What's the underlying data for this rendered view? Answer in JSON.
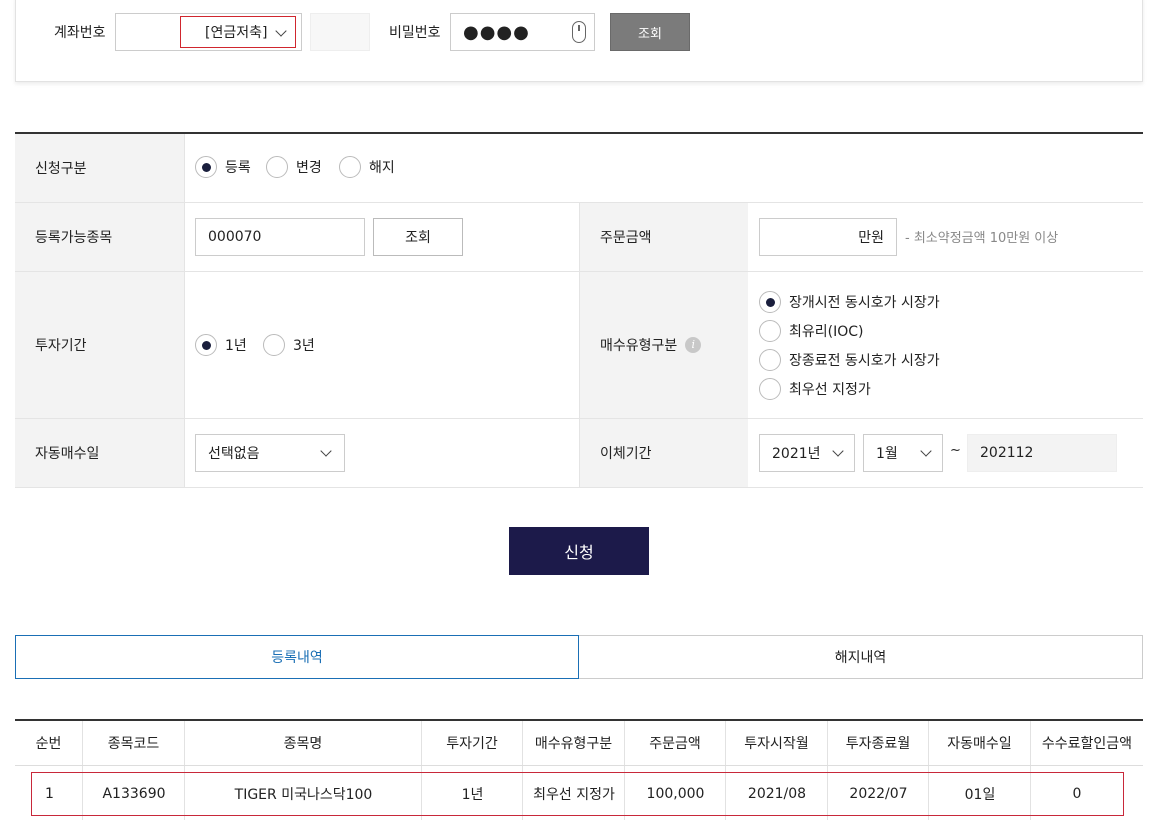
{
  "search": {
    "account_label": "계좌번호",
    "account_type": "[연금저축]",
    "password_label": "비밀번호",
    "password_mask": "●●●●",
    "query_button": "조회"
  },
  "form": {
    "apply_type_label": "신청구분",
    "apply_options": [
      "등록",
      "변경",
      "해지"
    ],
    "apply_selected": "등록",
    "stock_label": "등록가능종목",
    "stock_code": "000070",
    "stock_query_button": "조회",
    "order_amount_label": "주문금액",
    "order_amount_unit": "만원",
    "order_amount_hint": "- 최소약정금액 10만원 이상",
    "period_label": "투자기간",
    "period_options": [
      "1년",
      "3년"
    ],
    "period_selected": "1년",
    "buy_type_label": "매수유형구분",
    "buy_type_options": [
      "장개시전 동시호가 시장가",
      "최유리(IOC)",
      "장종료전 동시호가 시장가",
      "최우선 지정가"
    ],
    "buy_type_selected": "장개시전 동시호가 시장가",
    "auto_buy_label": "자동매수일",
    "auto_buy_value": "선택없음",
    "transfer_label": "이체기간",
    "transfer_year": "2021년",
    "transfer_month": "1월",
    "transfer_tilde": "~",
    "transfer_end": "202112",
    "submit_button": "신청"
  },
  "tabs": [
    "등록내역",
    "해지내역"
  ],
  "tabs_active": "등록내역",
  "list": {
    "headers": [
      "순번",
      "종목코드",
      "종목명",
      "투자기간",
      "매수유형구분",
      "주문금액",
      "투자시작월",
      "투자종료월",
      "자동매수일",
      "수수료할인금액"
    ],
    "rows": [
      [
        "1",
        "A133690",
        "TIGER 미국나스닥100",
        "1년",
        "최우선 지정가",
        "100,000",
        "2021/08",
        "2022/07",
        "01일",
        "0"
      ]
    ]
  },
  "colors": {
    "accent": "#1c1a4a",
    "tab_active": "#1a6fb5",
    "highlight_border": "#c8283a"
  }
}
